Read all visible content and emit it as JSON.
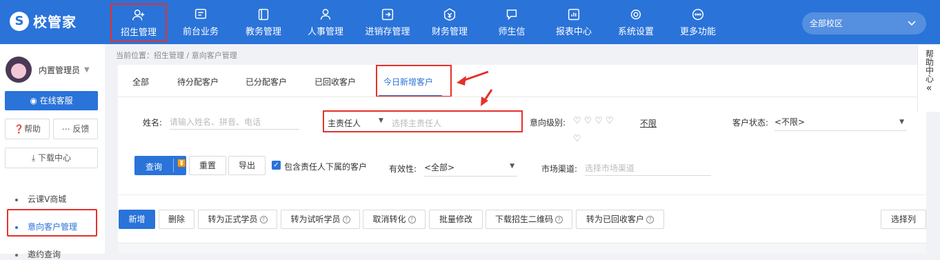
{
  "app": {
    "logo_text": "校管家",
    "logo_mark": "S"
  },
  "nav": [
    {
      "label": "招生管理",
      "icon": "person-add-icon",
      "active": true
    },
    {
      "label": "前台业务",
      "icon": "monitor-icon"
    },
    {
      "label": "教务管理",
      "icon": "book-icon"
    },
    {
      "label": "人事管理",
      "icon": "person-icon"
    },
    {
      "label": "进销存管理",
      "icon": "inventory-icon"
    },
    {
      "label": "财务管理",
      "icon": "finance-icon"
    },
    {
      "label": "师生信",
      "icon": "chat-icon"
    },
    {
      "label": "报表中心",
      "icon": "report-icon"
    },
    {
      "label": "系统设置",
      "icon": "gear-icon"
    },
    {
      "label": "更多功能",
      "icon": "more-icon"
    }
  ],
  "campus": {
    "label": "全部校区"
  },
  "sidebar": {
    "user_name": "内置管理员",
    "online_service": "在线客服",
    "help": "帮助",
    "feedback": "反馈",
    "download": "下载中心",
    "links": [
      {
        "label": "云课V商城"
      },
      {
        "label": "意向客户管理",
        "active": true
      },
      {
        "label": "邀约查询"
      }
    ]
  },
  "breadcrumb": "当前位置：招生管理 / 意向客户管理",
  "tabs": [
    {
      "label": "全部"
    },
    {
      "label": "待分配客户"
    },
    {
      "label": "已分配客户"
    },
    {
      "label": "已回收客户"
    },
    {
      "label": "今日新增客户",
      "active": true
    }
  ],
  "filters": {
    "name_label": "姓名:",
    "name_placeholder": "请输入姓名、拼音、电话",
    "owner_select": "主责任人",
    "owner_placeholder": "选择主责任人",
    "level_label": "意向级别:",
    "level_unlimited": "不限",
    "status_label": "客户状态:",
    "status_value": "<不限>",
    "validity_label": "有效性:",
    "validity_value": "<全部>",
    "channel_label": "市场渠道:",
    "channel_placeholder": "选择市场渠道"
  },
  "query": {
    "search": "查询",
    "reset": "重置",
    "export": "导出",
    "include_sub_label": "包含责任人下属的客户",
    "include_sub_checked": true
  },
  "actions": {
    "add": "新增",
    "delete": "删除",
    "to_formal": "转为正式学员",
    "to_trial": "转为试听学员",
    "cancel_convert": "取消转化",
    "batch_edit": "批量修改",
    "download_qr": "下载招生二维码",
    "to_recycled": "转为已回收客户",
    "select_columns": "选择列"
  },
  "help_strip": {
    "label": "帮助中心"
  },
  "colors": {
    "primary": "#2a73d9",
    "highlight": "#e4312b"
  }
}
